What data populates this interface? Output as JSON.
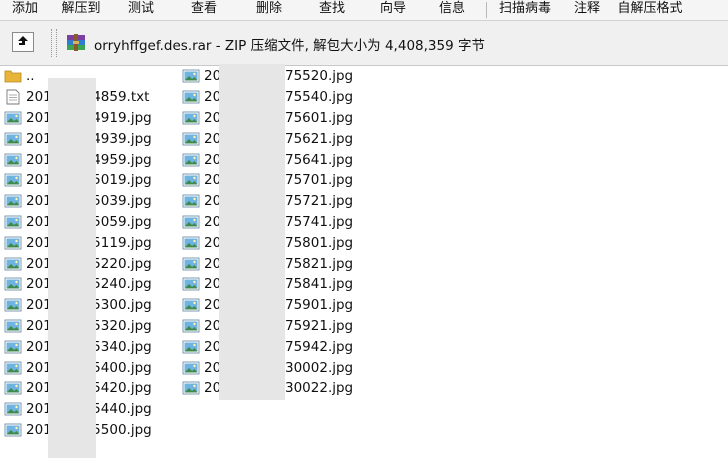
{
  "toolbar": {
    "buttons": [
      "添加",
      "解压到",
      "测试",
      "查看",
      "删除",
      "查找",
      "向导",
      "信息",
      "扫描病毒",
      "注释",
      "自解压格式"
    ]
  },
  "address": {
    "text": "orryhffgef.des.rar - ZIP 压缩文件, 解包大小为 4,408,359 字节"
  },
  "icons": {
    "up": "up-folder-icon",
    "archive": "rar-archive-icon",
    "folder": "folder-icon",
    "txt": "text-file-icon",
    "jpg": "image-file-icon"
  },
  "files": {
    "col1": [
      {
        "head": "..",
        "tail": "",
        "type": "folder"
      },
      {
        "head": "201",
        "tail": "174859.txt",
        "type": "txt"
      },
      {
        "head": "201",
        "tail": "174919.jpg",
        "type": "jpg"
      },
      {
        "head": "201",
        "tail": "174939.jpg",
        "type": "jpg"
      },
      {
        "head": "201",
        "tail": "174959.jpg",
        "type": "jpg"
      },
      {
        "head": "201",
        "tail": "175019.jpg",
        "type": "jpg"
      },
      {
        "head": "201",
        "tail": "175039.jpg",
        "type": "jpg"
      },
      {
        "head": "201",
        "tail": "175059.jpg",
        "type": "jpg"
      },
      {
        "head": "201",
        "tail": "175119.jpg",
        "type": "jpg"
      },
      {
        "head": "201",
        "tail": "175220.jpg",
        "type": "jpg"
      },
      {
        "head": "201",
        "tail": "175240.jpg",
        "type": "jpg"
      },
      {
        "head": "201",
        "tail": "175300.jpg",
        "type": "jpg"
      },
      {
        "head": "201",
        "tail": "175320.jpg",
        "type": "jpg"
      },
      {
        "head": "201",
        "tail": "175340.jpg",
        "type": "jpg"
      },
      {
        "head": "201",
        "tail": "175400.jpg",
        "type": "jpg"
      },
      {
        "head": "201",
        "tail": "175420.jpg",
        "type": "jpg"
      },
      {
        "head": "201",
        "tail": "175440.jpg",
        "type": "jpg"
      },
      {
        "head": "201",
        "tail": "175500.jpg",
        "type": "jpg"
      }
    ],
    "col2": [
      {
        "head": "20",
        "tail": "75520.jpg",
        "type": "jpg"
      },
      {
        "head": "20",
        "tail": "75540.jpg",
        "type": "jpg"
      },
      {
        "head": "20",
        "tail": "75601.jpg",
        "type": "jpg"
      },
      {
        "head": "20",
        "tail": "75621.jpg",
        "type": "jpg"
      },
      {
        "head": "20",
        "tail": "75641.jpg",
        "type": "jpg"
      },
      {
        "head": "20",
        "tail": "75701.jpg",
        "type": "jpg"
      },
      {
        "head": "20",
        "tail": "75721.jpg",
        "type": "jpg"
      },
      {
        "head": "20",
        "tail": "75741.jpg",
        "type": "jpg"
      },
      {
        "head": "20",
        "tail": "75801.jpg",
        "type": "jpg"
      },
      {
        "head": "20",
        "tail": "75821.jpg",
        "type": "jpg"
      },
      {
        "head": "20",
        "tail": "75841.jpg",
        "type": "jpg"
      },
      {
        "head": "20",
        "tail": "75901.jpg",
        "type": "jpg"
      },
      {
        "head": "20",
        "tail": "75921.jpg",
        "type": "jpg"
      },
      {
        "head": "20",
        "tail": "75942.jpg",
        "type": "jpg"
      },
      {
        "head": "20",
        "tail": "30002.jpg",
        "type": "jpg"
      },
      {
        "head": "20",
        "tail": "30022.jpg",
        "type": "jpg"
      }
    ]
  },
  "colors": {
    "toolbar_bg": "#f5f5f5",
    "address_bg": "#f0f0f0",
    "redaction": "#e6e6e6"
  }
}
